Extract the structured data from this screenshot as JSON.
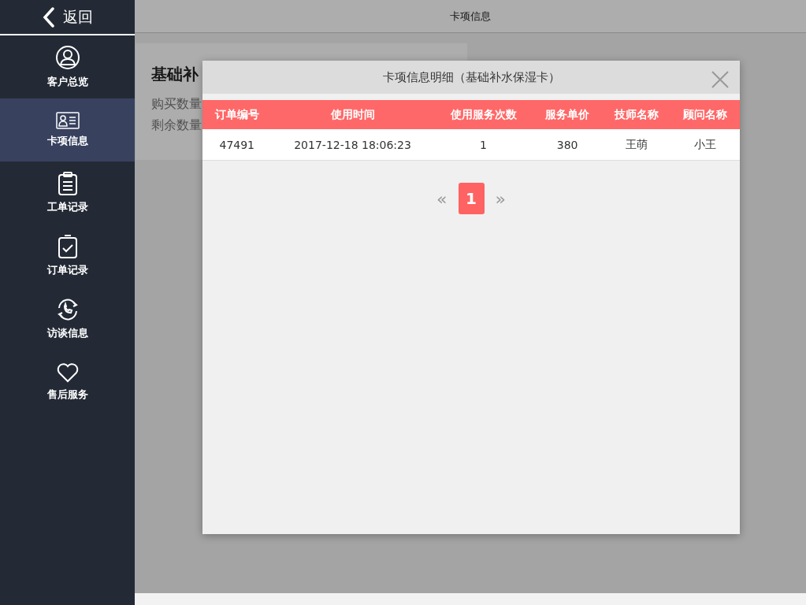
{
  "sidebar": {
    "back_label": "返回",
    "items": [
      {
        "label": "客户总览",
        "selected": false
      },
      {
        "label": "卡项信息",
        "selected": true
      },
      {
        "label": "工单记录",
        "selected": false
      },
      {
        "label": "订单记录",
        "selected": false
      },
      {
        "label": "访谈信息",
        "selected": false
      },
      {
        "label": "售后服务",
        "selected": false
      }
    ]
  },
  "header": {
    "title": "卡项信息"
  },
  "card": {
    "title": "基础补",
    "lines": [
      "购买数量",
      "剩余数量"
    ]
  },
  "modal": {
    "title": "卡项信息明细（基础补水保湿卡）",
    "table": {
      "columns": [
        "订单编号",
        "使用时间",
        "使用服务次数",
        "服务单价",
        "技师名称",
        "顾问名称"
      ],
      "rows": [
        [
          "47491",
          "2017-12-18 18:06:23",
          "1",
          "380",
          "王萌",
          "小王"
        ]
      ]
    },
    "pagination": {
      "prev": "«",
      "next": "»",
      "pages": [
        {
          "label": "1",
          "selected": true
        }
      ]
    }
  }
}
